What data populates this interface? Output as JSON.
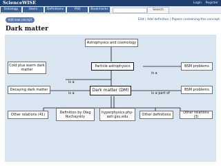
{
  "header": {
    "brand": "ScienceWISE",
    "login": "Login",
    "register": "Register"
  },
  "nav": {
    "tabs": [
      "Ontology",
      "Users",
      "Definitions",
      "FAQ",
      "Bookmarks"
    ],
    "search_button": "Search",
    "search_placeholder": ""
  },
  "toolbar": {
    "add_concept": "Add new concept",
    "edit": "Edit",
    "add_definition": "Add definition",
    "papers": "Papers containing this concept"
  },
  "page": {
    "title": "Dark matter"
  },
  "graph": {
    "nodes": {
      "astro_cosmo": "Astrophysics and cosmology",
      "particle_astro": "Particle astrophysics",
      "cold_warm": "Cold plus warm dark matter",
      "bsm1": "BSM problems",
      "decaying": "Decaying dark matter",
      "dark_matter": "Dark matter (DM)",
      "bsm2": "BSM problems",
      "other_rel_41": "Other relations (41)",
      "def_oleg": "Definition by Oleg Ruchayskiy",
      "hyperphysics": "hyperphysics.phy-astr.gsu.edu",
      "other_defs": "Other definitions",
      "other_rel_3": "Other relations (3)"
    },
    "edges": {
      "is_a_top_right": "is a",
      "is_a_left_upper": "is a",
      "is_a_left_lower": "is a",
      "is_a_part_of": "is a part of"
    }
  },
  "colors": {
    "topbar": "#1f3f6e",
    "tab": "#3a5f96",
    "panel": "#d9e6f2",
    "link": "#1f4fa0"
  }
}
